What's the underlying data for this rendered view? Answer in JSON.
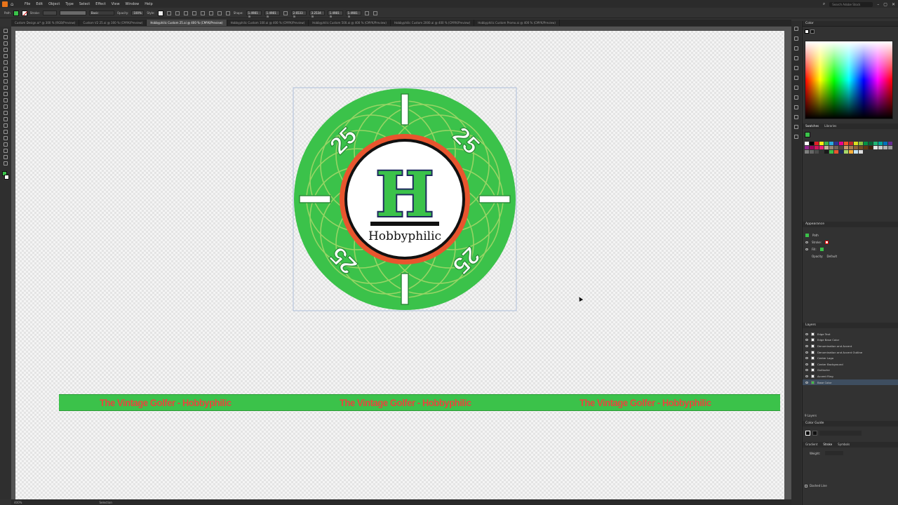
{
  "menubar": {
    "items": [
      "File",
      "Edit",
      "Object",
      "Type",
      "Select",
      "Effect",
      "View",
      "Window",
      "Help"
    ],
    "search_placeholder": "Search Adobe Stock"
  },
  "control": {
    "object_type": "Path",
    "stroke_label": "Stroke:",
    "style_label": "Basic",
    "opacity_label": "Opacity:",
    "opacity_value": "100%",
    "style2_label": "Style:",
    "shape_label": "Shape:",
    "x": "1.4981 in",
    "y": "1.4981 in",
    "w": "2.6533 in",
    "h": "3.2534 in",
    "w2": "1.4981 in",
    "h2": "1.4981 in"
  },
  "tabs": [
    "Custom Design.ai* @ 300 % (RGB/Preview)",
    "Custom V2 25.ai @ 300 % (CMYK/Preview)",
    "Hobbyphilic Custom 25.ai @ 400 % (CMYK/Preview)",
    "Hobbyphilic Custom 100.ai @ 400 % (CMYK/Preview)",
    "Hobbyphilic Custom 500.ai @ 400 % (CMYK/Preview)",
    "Hobbyphilic Custom 2000.ai @ 400 % (CMYK/Preview)",
    "Hobbyphilic Custom Promo.ai @ 400 % (CMYK/Preview)"
  ],
  "active_tab_index": 2,
  "artwork": {
    "center_letter": "H",
    "brand_text": "Hobbyphilic",
    "denomination": "25",
    "colors": {
      "base": "#3bc24a",
      "accent_ring": "#e8552e",
      "navy": "#1e2a5e",
      "line": "#a8d86a"
    }
  },
  "banner": {
    "texts": [
      "The Vintage Golfer - Hobbyphilic",
      "The Vintage Golfer - Hobbyphilic",
      "The Vintage Golfer - Hobbyphilic"
    ]
  },
  "status": {
    "zoom": "400%",
    "tool": "Selection"
  },
  "panels": {
    "color_title": "Color",
    "swatches_tabs": [
      "Swatches",
      "Libraries"
    ],
    "appearance_title": "Appearance",
    "appearance_rows": [
      {
        "label": "Path",
        "value": ""
      },
      {
        "label": "Stroke:",
        "value": ""
      },
      {
        "label": "Fill:",
        "value": ""
      },
      {
        "label": "Opacity:",
        "value": "Default"
      }
    ],
    "layers_title": "Layers",
    "layers": [
      "Edge Text",
      "Edge Base Color",
      "Denomination and Accent",
      "Denomination and Accent Outline",
      "Center Logo",
      "Center Background",
      "Guilloche",
      "Accent Ring",
      "Base Color"
    ],
    "layers_count": "9 Layers",
    "color_guide_title": "Color Guide",
    "stroke_tabs": [
      "Gradient",
      "Stroke",
      "Symbols"
    ],
    "weight_label": "Weight:",
    "dashed_label": "Dashed Line"
  }
}
